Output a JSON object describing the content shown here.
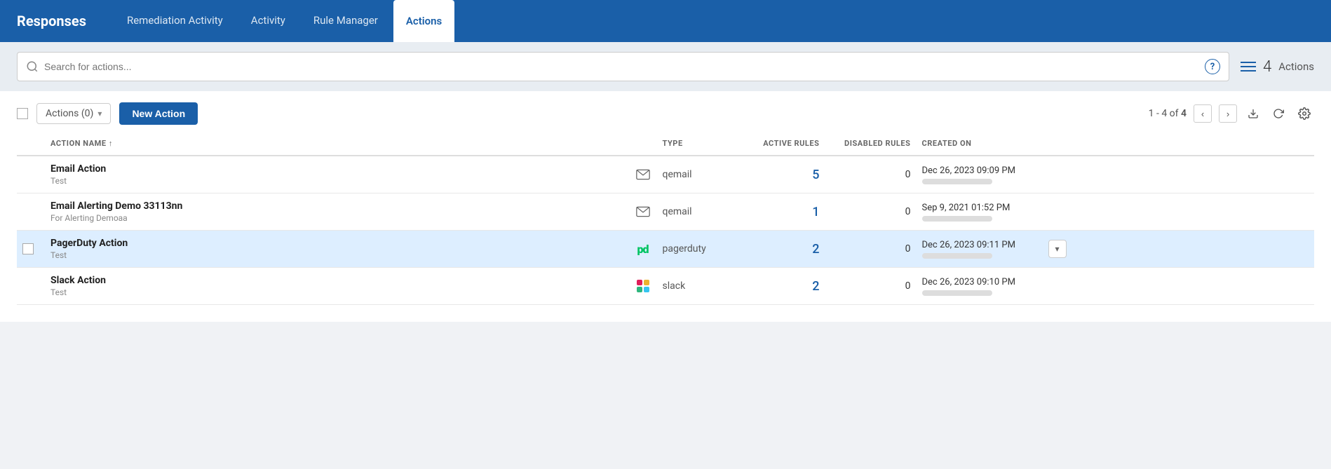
{
  "brand": "Responses",
  "nav": {
    "items": [
      {
        "id": "remediation",
        "label": "Remediation Activity",
        "active": false
      },
      {
        "id": "activity",
        "label": "Activity",
        "active": false
      },
      {
        "id": "rule-manager",
        "label": "Rule Manager",
        "active": false
      },
      {
        "id": "actions",
        "label": "Actions",
        "active": true
      }
    ]
  },
  "search": {
    "placeholder": "Search for actions..."
  },
  "header": {
    "count": "4",
    "label": "Actions"
  },
  "toolbar": {
    "actions_dropdown": "Actions (0)",
    "new_action": "New Action",
    "pagination": "1 - 4 of",
    "total": "4"
  },
  "table": {
    "columns": [
      {
        "id": "name",
        "label": "ACTION NAME ↑"
      },
      {
        "id": "type",
        "label": "TYPE"
      },
      {
        "id": "active_rules",
        "label": "ACTIVE RULES"
      },
      {
        "id": "disabled_rules",
        "label": "DISABLED RULES"
      },
      {
        "id": "created_on",
        "label": "CREATED ON"
      }
    ],
    "rows": [
      {
        "id": "email-action",
        "name": "Email Action",
        "description": "Test",
        "type_icon": "email",
        "type": "qemail",
        "active_rules": "5",
        "disabled_rules": "0",
        "created_on": "Dec 26, 2023 09:09 PM",
        "highlighted": false
      },
      {
        "id": "email-alerting",
        "name": "Email Alerting Demo 33113nn",
        "description": "For Alerting Demoaa",
        "type_icon": "email",
        "type": "qemail",
        "active_rules": "1",
        "disabled_rules": "0",
        "created_on": "Sep 9, 2021 01:52 PM",
        "highlighted": false
      },
      {
        "id": "pagerduty-action",
        "name": "PagerDuty Action",
        "description": "Test",
        "type_icon": "pagerduty",
        "type": "pagerduty",
        "active_rules": "2",
        "disabled_rules": "0",
        "created_on": "Dec 26, 2023 09:11 PM",
        "highlighted": true
      },
      {
        "id": "slack-action",
        "name": "Slack Action",
        "description": "Test",
        "type_icon": "slack",
        "type": "slack",
        "active_rules": "2",
        "disabled_rules": "0",
        "created_on": "Dec 26, 2023 09:10 PM",
        "highlighted": false
      }
    ]
  }
}
